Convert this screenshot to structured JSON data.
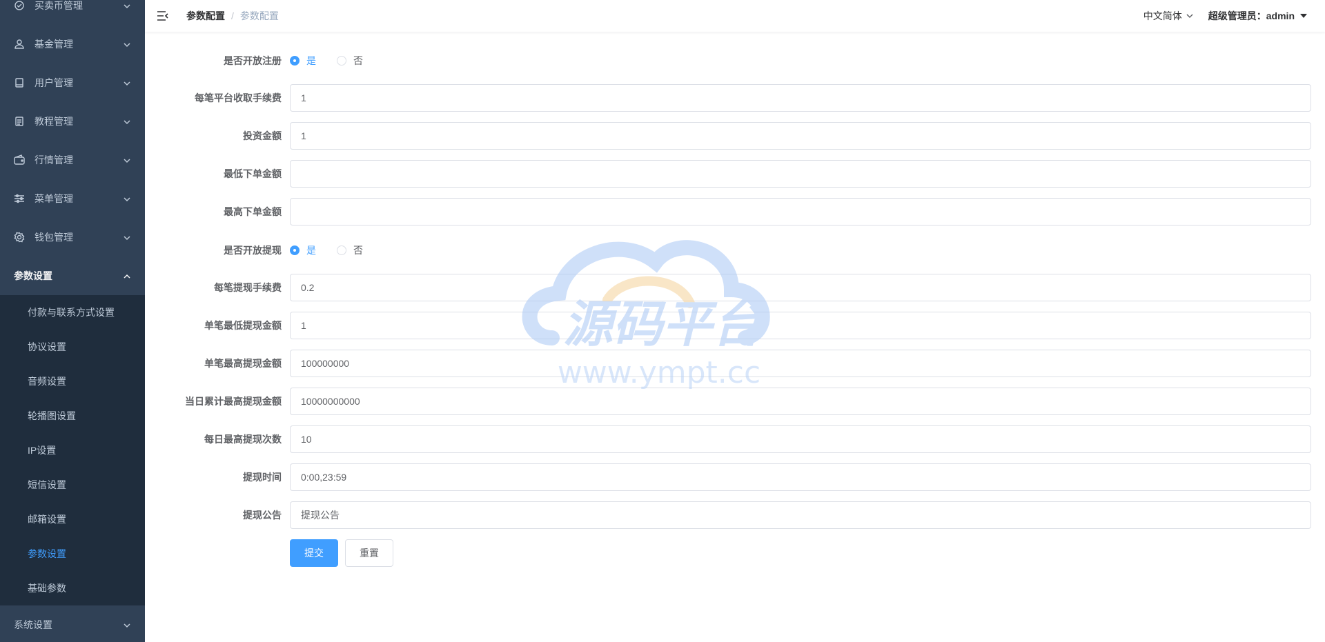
{
  "sidebar": {
    "items": [
      {
        "label": "买卖币管理",
        "icon": "check-circle-icon"
      },
      {
        "label": "基金管理",
        "icon": "user-icon"
      },
      {
        "label": "用户管理",
        "icon": "book-icon"
      },
      {
        "label": "教程管理",
        "icon": "document-icon"
      },
      {
        "label": "行情管理",
        "icon": "wallet-icon"
      },
      {
        "label": "菜单管理",
        "icon": "sliders-icon"
      },
      {
        "label": "钱包管理",
        "icon": "gear-icon"
      },
      {
        "label": "参数设置",
        "icon": ""
      }
    ],
    "submenu": [
      {
        "label": "付款与联系方式设置"
      },
      {
        "label": "协议设置"
      },
      {
        "label": "音频设置"
      },
      {
        "label": "轮播图设置"
      },
      {
        "label": "IP设置"
      },
      {
        "label": "短信设置"
      },
      {
        "label": "邮箱设置"
      },
      {
        "label": "参数设置"
      },
      {
        "label": "基础参数"
      }
    ],
    "bottom_item": {
      "label": "系统设置"
    }
  },
  "navbar": {
    "breadcrumb": [
      "参数配置",
      "参数配置"
    ],
    "separator": "/",
    "language": "中文简体",
    "user": "超级管理员：admin"
  },
  "form": {
    "open_register": {
      "label": "是否开放注册",
      "options": [
        "是",
        "否"
      ],
      "selected": "是"
    },
    "platform_fee": {
      "label": "每笔平台收取手续费",
      "value": "1"
    },
    "invest_amount": {
      "label": "投资金额",
      "value": "1"
    },
    "min_order": {
      "label": "最低下单金额",
      "value": ""
    },
    "max_order": {
      "label": "最高下单金额",
      "value": ""
    },
    "open_withdraw": {
      "label": "是否开放提现",
      "options": [
        "是",
        "否"
      ],
      "selected": "是"
    },
    "withdraw_fee": {
      "label": "每笔提现手续费",
      "value": "0.2"
    },
    "min_withdraw": {
      "label": "单笔最低提现金额",
      "value": "1"
    },
    "max_withdraw": {
      "label": "单笔最高提现金额",
      "value": "100000000"
    },
    "daily_max_withdraw": {
      "label": "当日累计最高提现金额",
      "value": "10000000000"
    },
    "daily_withdraw_times": {
      "label": "每日最高提现次数",
      "value": "10"
    },
    "withdraw_time": {
      "label": "提现时间",
      "value": "0:00,23:59"
    },
    "withdraw_notice": {
      "label": "提现公告",
      "value": "提现公告"
    },
    "submit": "提交",
    "reset": "重置"
  },
  "watermark": {
    "title": "源码平台",
    "url": "www.ympt.cc"
  },
  "colors": {
    "sidebar_bg": "#304156",
    "submenu_bg": "#1f2d3d",
    "accent": "#409eff"
  }
}
